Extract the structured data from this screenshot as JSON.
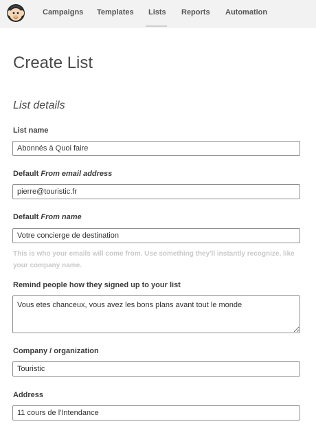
{
  "nav": {
    "logo_icon": "mailchimp-monkey-icon",
    "items": [
      {
        "label": "Campaigns"
      },
      {
        "label": "Templates"
      },
      {
        "label": "Lists"
      },
      {
        "label": "Reports"
      },
      {
        "label": "Automation"
      }
    ],
    "active": "Lists"
  },
  "page": {
    "title": "Create List",
    "section_title": "List details"
  },
  "form": {
    "list_name": {
      "label": "List name",
      "value": "Abonnés à Quoi faire"
    },
    "from_email": {
      "label_prefix": "Default",
      "label_italic": "From email address",
      "value": "pierre@touristic.fr"
    },
    "from_name": {
      "label_prefix": "Default",
      "label_italic": "From name",
      "value": "Votre concierge de destination",
      "help": "This is who your emails will come from. Use something they'll instantly recognize, like your company name."
    },
    "reminder": {
      "label": "Remind people how they signed up to your list",
      "value": "Vous etes chanceux, vous avez les bons plans avant tout le monde"
    },
    "company": {
      "label": "Company / organization",
      "value": "Touristic"
    },
    "address": {
      "label": "Address",
      "value": "11 cours de l'Intendance"
    }
  },
  "colors": {
    "topbar_bg": "#f2f2f2",
    "field_border": "#8e8e8e",
    "help_text": "#c9c9c9"
  }
}
